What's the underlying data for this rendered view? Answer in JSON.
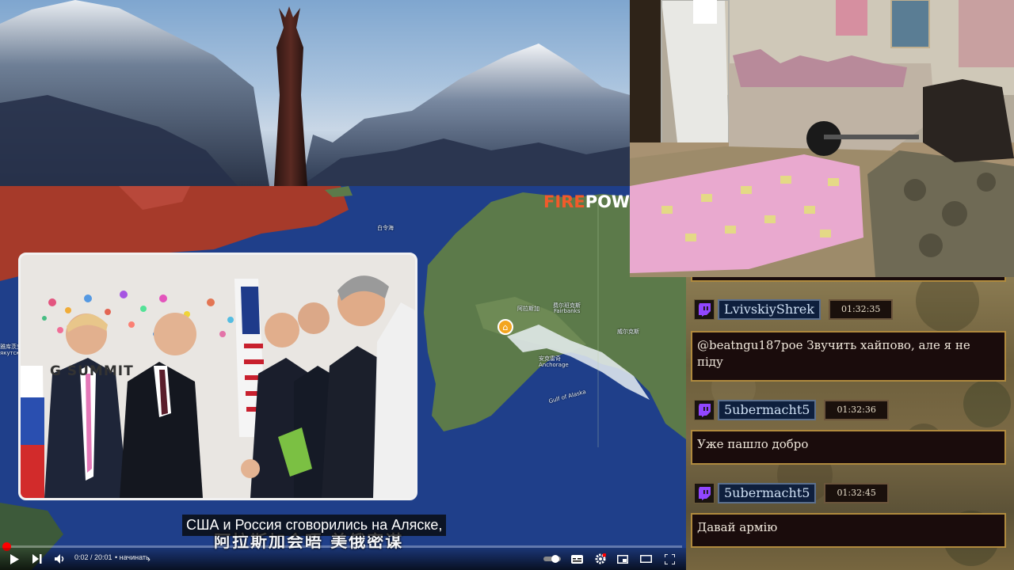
{
  "map": {
    "brand_fire": "FIRE",
    "brand_pow": "POW",
    "labels": {
      "bering": "白令海",
      "fairbanks_cn": "费尔班克斯",
      "fairbanks": "Fairbanks",
      "city_cn": "阿拉斯加",
      "anchorage_cn": "安克雷奇",
      "anchorage": "Anchorage",
      "gulf": "Gulf of Alaska",
      "east_cn": "威尔克斯",
      "west_cn": "雅库茨克",
      "west_small": "якутск"
    },
    "colors": {
      "ocean": "#1f3f8a",
      "land": "#5c7a4a",
      "russia": "#a63a2a"
    }
  },
  "inset": {
    "summit_text": "G   SUMMIT"
  },
  "subtitle": {
    "text": "США и Россия сговорились на Аляске,",
    "burned_caption": "阿拉斯加会晤 美俄密谋"
  },
  "player": {
    "time": "0:02 / 20:01",
    "chapter": "• начинать",
    "progress_fraction": 0.0017,
    "icons": {
      "play": "play-icon",
      "next": "next-icon",
      "volume": "volume-icon",
      "chevron": "chevron-right-icon",
      "autoplay": "autoplay-toggle",
      "subtitles": "subtitles-icon",
      "settings": "settings-icon",
      "miniplayer": "miniplayer-icon",
      "theater": "theater-icon",
      "fullscreen": "fullscreen-icon"
    },
    "accent": "#ff0000"
  },
  "chat": {
    "messages": [
      {
        "user": "LvivskiyShrek",
        "time": "01:32:35",
        "text": "@beatngu187poe Звучить хайпово, але я не піду"
      },
      {
        "user": "5ubermacht5",
        "time": "01:32:36",
        "text": "Уже пашло добро"
      },
      {
        "user": "5ubermacht5",
        "time": "01:32:45",
        "text": "Давай армію"
      }
    ],
    "badge_icon": "twitch-icon",
    "colors": {
      "username_bg": "#0e1f3d",
      "message_bg": "#1a0c0c",
      "border": "#b08a3e"
    }
  }
}
